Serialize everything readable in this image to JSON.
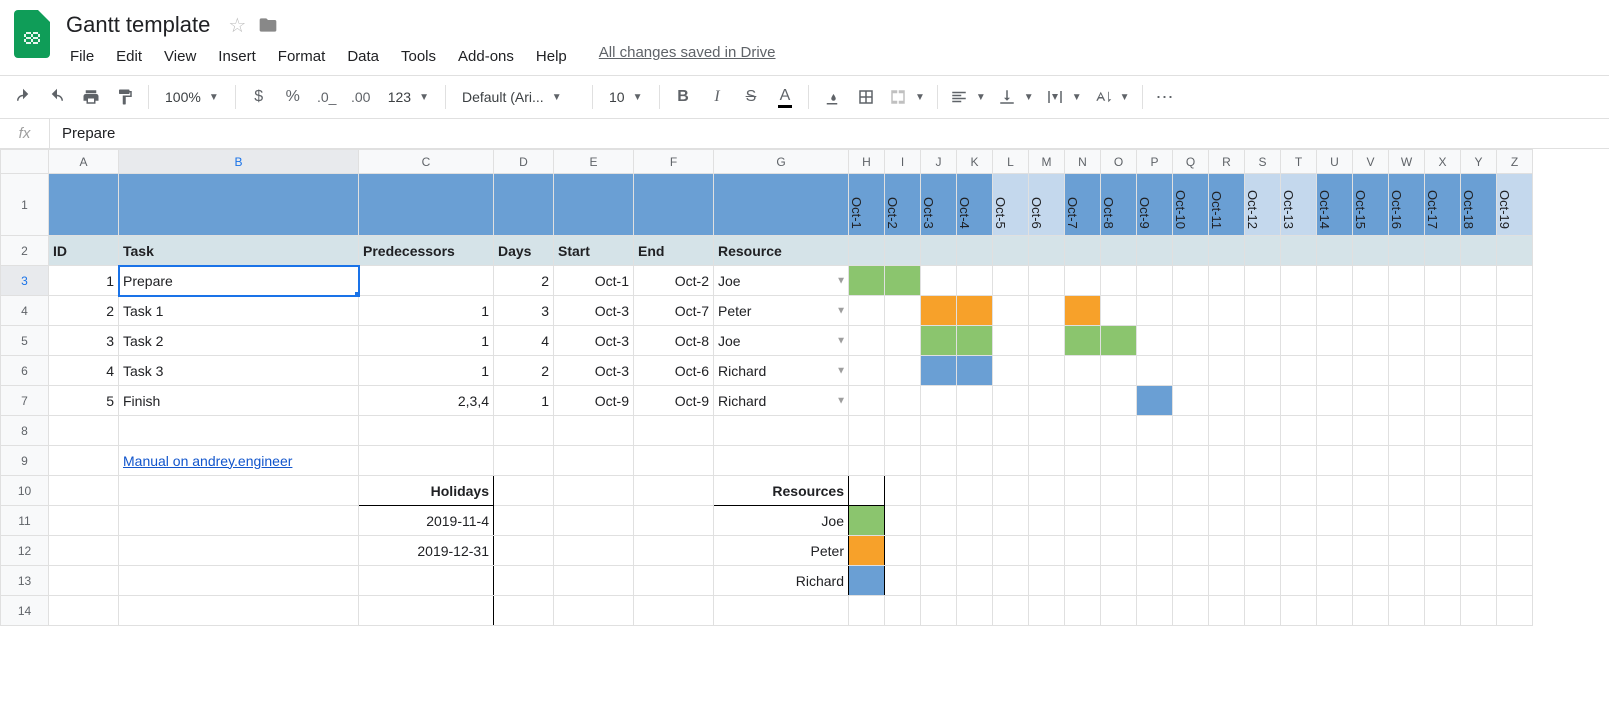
{
  "app": {
    "title": "Gantt template",
    "saved_status": "All changes saved in Drive"
  },
  "menubar": [
    "File",
    "Edit",
    "View",
    "Insert",
    "Format",
    "Data",
    "Tools",
    "Add-ons",
    "Help"
  ],
  "toolbar": {
    "zoom": "100%",
    "font": "Default (Ari...",
    "font_size": "10",
    "num_123": "123"
  },
  "formula": {
    "value": "Prepare"
  },
  "columns": {
    "main": [
      "A",
      "B",
      "C",
      "D",
      "E",
      "F",
      "G"
    ],
    "dates": [
      "H",
      "I",
      "J",
      "K",
      "L",
      "M",
      "N",
      "O",
      "P",
      "Q",
      "R",
      "S",
      "T",
      "U",
      "V",
      "W",
      "X",
      "Y",
      "Z"
    ]
  },
  "col_widths": {
    "A": 70,
    "B": 240,
    "C": 135,
    "D": 60,
    "E": 80,
    "F": 80,
    "G": 135,
    "date": 36
  },
  "row_numbers": [
    1,
    2,
    3,
    4,
    5,
    6,
    7,
    8,
    9,
    10,
    11,
    12,
    13,
    14
  ],
  "date_headers": [
    {
      "label": "Oct-1",
      "weekend": false
    },
    {
      "label": "Oct-2",
      "weekend": false
    },
    {
      "label": "Oct-3",
      "weekend": false
    },
    {
      "label": "Oct-4",
      "weekend": false
    },
    {
      "label": "Oct-5",
      "weekend": true
    },
    {
      "label": "Oct-6",
      "weekend": true
    },
    {
      "label": "Oct-7",
      "weekend": false
    },
    {
      "label": "Oct-8",
      "weekend": false
    },
    {
      "label": "Oct-9",
      "weekend": false
    },
    {
      "label": "Oct-10",
      "weekend": false
    },
    {
      "label": "Oct-11",
      "weekend": false
    },
    {
      "label": "Oct-12",
      "weekend": true
    },
    {
      "label": "Oct-13",
      "weekend": true
    },
    {
      "label": "Oct-14",
      "weekend": false
    },
    {
      "label": "Oct-15",
      "weekend": false
    },
    {
      "label": "Oct-16",
      "weekend": false
    },
    {
      "label": "Oct-17",
      "weekend": false
    },
    {
      "label": "Oct-18",
      "weekend": false
    },
    {
      "label": "Oct-19",
      "weekend": true
    }
  ],
  "header_row": {
    "id": "ID",
    "task": "Task",
    "predecessors": "Predecessors",
    "days": "Days",
    "start": "Start",
    "end": "End",
    "resource": "Resource"
  },
  "tasks": [
    {
      "id": "1",
      "task": "Prepare",
      "pred": "",
      "days": "2",
      "start": "Oct-1",
      "end": "Oct-2",
      "resource": "Joe",
      "bars": [
        {
          "col": 0,
          "color": "green"
        },
        {
          "col": 1,
          "color": "green"
        }
      ]
    },
    {
      "id": "2",
      "task": "Task 1",
      "pred": "1",
      "days": "3",
      "start": "Oct-3",
      "end": "Oct-7",
      "resource": "Peter",
      "bars": [
        {
          "col": 2,
          "color": "orange"
        },
        {
          "col": 3,
          "color": "orange"
        },
        {
          "col": 6,
          "color": "orange"
        }
      ]
    },
    {
      "id": "3",
      "task": "Task 2",
      "pred": "1",
      "days": "4",
      "start": "Oct-3",
      "end": "Oct-8",
      "resource": "Joe",
      "bars": [
        {
          "col": 2,
          "color": "green"
        },
        {
          "col": 3,
          "color": "green"
        },
        {
          "col": 6,
          "color": "green"
        },
        {
          "col": 7,
          "color": "green"
        }
      ]
    },
    {
      "id": "4",
      "task": "Task 3",
      "pred": "1",
      "days": "2",
      "start": "Oct-3",
      "end": "Oct-6",
      "resource": "Richard",
      "bars": [
        {
          "col": 2,
          "color": "blue"
        },
        {
          "col": 3,
          "color": "blue"
        }
      ]
    },
    {
      "id": "5",
      "task": "Finish",
      "pred": "2,3,4",
      "days": "1",
      "start": "Oct-9",
      "end": "Oct-9",
      "resource": "Richard",
      "bars": [
        {
          "col": 8,
          "color": "blue"
        }
      ]
    }
  ],
  "link_text": "Manual on andrey.engineer",
  "holidays": {
    "header": "Holidays",
    "rows": [
      "2019-11-4",
      "2019-12-31"
    ]
  },
  "resources": {
    "header": "Resources",
    "rows": [
      {
        "name": "Joe",
        "color": "green"
      },
      {
        "name": "Peter",
        "color": "orange"
      },
      {
        "name": "Richard",
        "color": "blue"
      }
    ]
  },
  "selected_cell": {
    "row": 3,
    "col": "B"
  }
}
